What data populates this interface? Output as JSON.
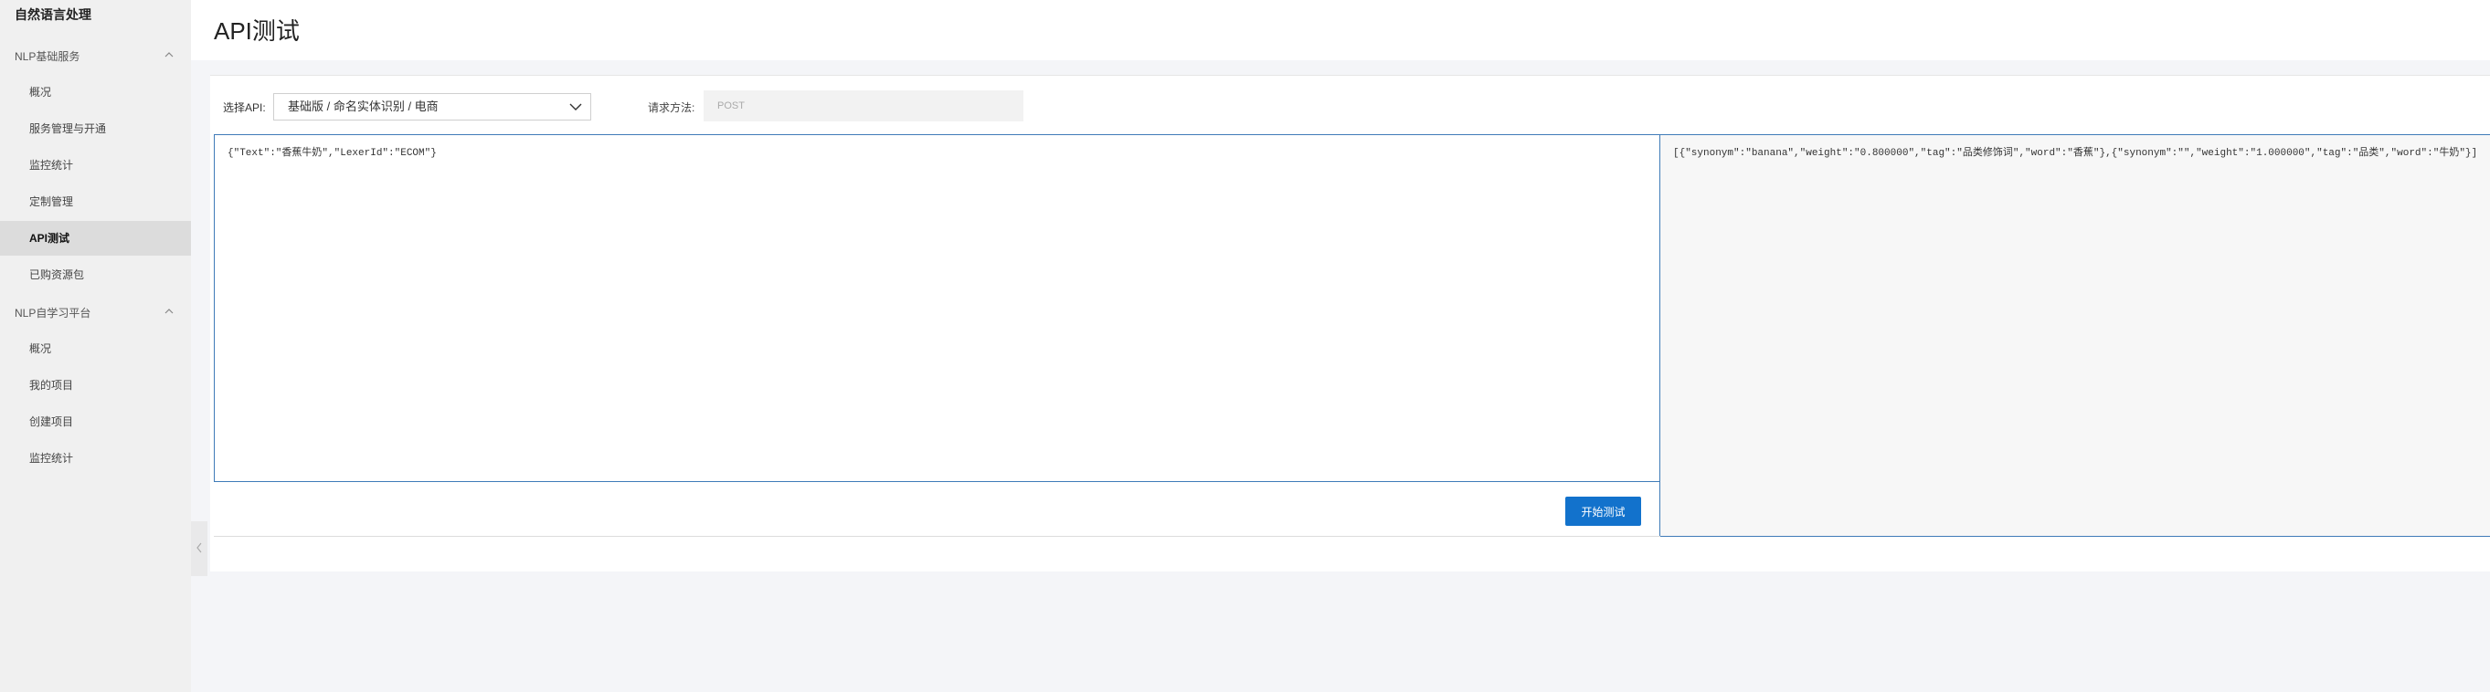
{
  "sidebar": {
    "title": "自然语言处理",
    "groups": [
      {
        "label": "NLP基础服务",
        "items": [
          "概况",
          "服务管理与开通",
          "监控统计",
          "定制管理",
          "API测试",
          "已购资源包"
        ]
      },
      {
        "label": "NLP自学习平台",
        "items": [
          "概况",
          "我的项目",
          "创建项目",
          "监控统计"
        ]
      }
    ],
    "active_item": "API测试"
  },
  "header": {
    "title": "API测试"
  },
  "form": {
    "api_label": "选择API:",
    "api_value": "基础版 / 命名实体识别 / 电商",
    "method_label": "请求方法:",
    "method_value": "POST"
  },
  "editor": {
    "content": "{\"Text\":\"香蕉牛奶\",\"LexerId\":\"ECOM\"}"
  },
  "output": {
    "content": "[{\"synonym\":\"banana\",\"weight\":\"0.800000\",\"tag\":\"品类修饰词\",\"word\":\"香蕉\"},{\"synonym\":\"\",\"weight\":\"1.000000\",\"tag\":\"品类\",\"word\":\"牛奶\"}]"
  },
  "actions": {
    "start_label": "开始测试"
  },
  "colors": {
    "primary": "#1272cc",
    "border_focus": "#3f7bb8",
    "sidebar_bg": "#f0f0f0",
    "active_bg": "#dcdcdc",
    "page_bg": "#f4f5f8"
  },
  "icons": [
    "chevron-up-icon",
    "chevron-down-icon",
    "chevron-left-icon"
  ]
}
